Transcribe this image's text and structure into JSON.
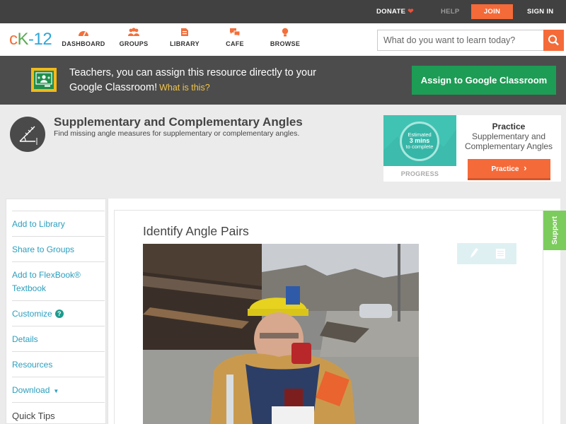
{
  "topbar": {
    "donate": "DONATE",
    "help": "HELP",
    "join": "JOIN",
    "signin": "SIGN IN"
  },
  "nav": {
    "logo": {
      "c": "c",
      "k": "K",
      "n": "-12"
    },
    "items": [
      {
        "label": "DASHBOARD",
        "icon": "dashboard-icon"
      },
      {
        "label": "GROUPS",
        "icon": "groups-icon"
      },
      {
        "label": "LIBRARY",
        "icon": "library-icon"
      },
      {
        "label": "CAFE",
        "icon": "cafe-icon"
      },
      {
        "label": "BROWSE",
        "icon": "browse-icon"
      }
    ],
    "search": {
      "placeholder": "What do you want to learn today?"
    }
  },
  "banner": {
    "text": "Teachers, you can assign this resource directly to your Google Classroom!",
    "what_is": "What is this?",
    "assign_button": "Assign to Google Classroom"
  },
  "concept": {
    "title": "Supplementary and Complementary Angles",
    "subtitle": "Find missing angle measures for supplementary or complementary angles."
  },
  "practice": {
    "estimated": "Estimated",
    "mins": "3 mins",
    "to_complete": "to complete",
    "progress_label": "PROGRESS",
    "heading": "Practice",
    "name": "Supplementary and Complementary Angles",
    "button": "Practice"
  },
  "sidebar": {
    "items": [
      {
        "label": "Add to Library"
      },
      {
        "label": "Share to Groups"
      },
      {
        "label": "Add to FlexBook® Textbook"
      },
      {
        "label": "Customize"
      },
      {
        "label": "Details"
      },
      {
        "label": "Resources"
      },
      {
        "label": "Download"
      },
      {
        "label": "Quick Tips"
      }
    ]
  },
  "content": {
    "title": "Identify Angle Pairs"
  },
  "support": {
    "label": "Support"
  },
  "colors": {
    "accent_orange": "#f56a39",
    "google_green": "#1d9c55",
    "link_blue": "#2b9ebd",
    "practice_teal": "#41c3b3",
    "support_green": "#7ccc5d"
  }
}
